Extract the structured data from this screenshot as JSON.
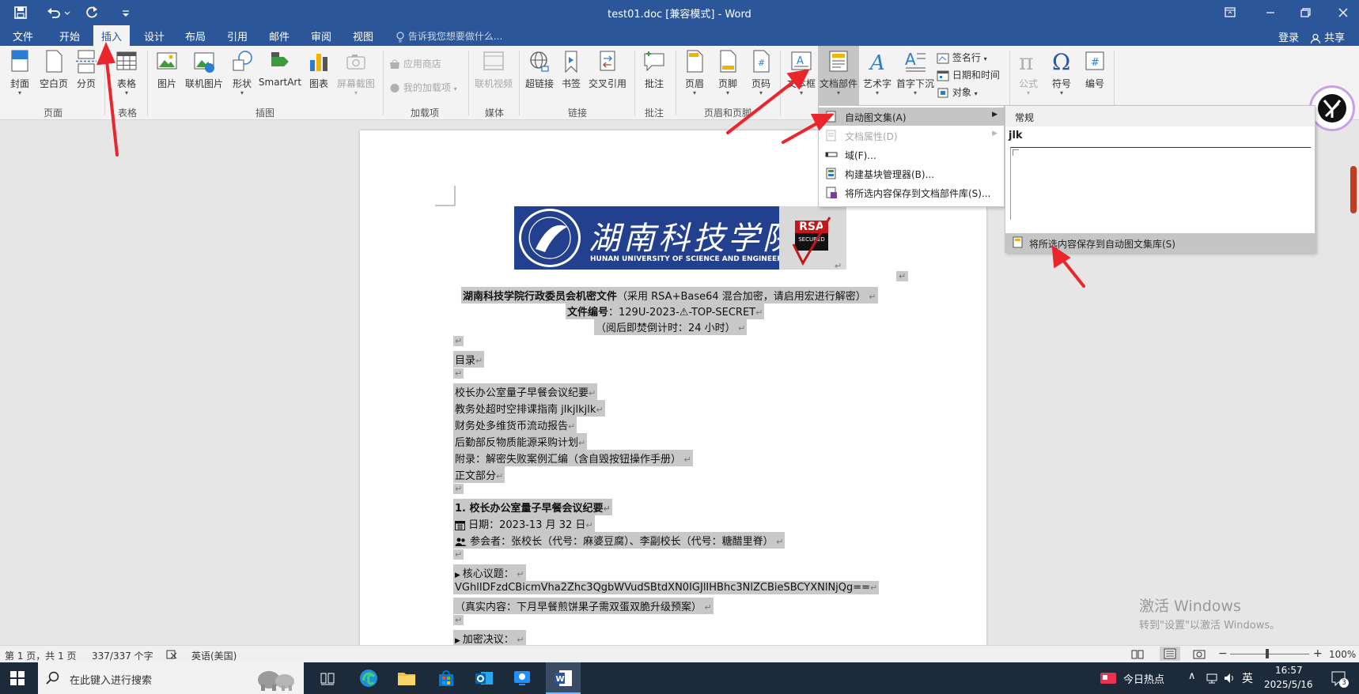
{
  "titlebar": {
    "title": "test01.doc [兼容模式] - Word"
  },
  "tabs": [
    "文件",
    "开始",
    "插入",
    "设计",
    "布局",
    "引用",
    "邮件",
    "审阅",
    "视图"
  ],
  "active_tab": "插入",
  "tell_me": "告诉我您想要做什么...",
  "account": {
    "login": "登录",
    "share": "共享"
  },
  "ribbon": {
    "pages": {
      "cover": "封面",
      "blank": "空白页",
      "break": "分页",
      "group": "页面"
    },
    "tables": {
      "table": "表格",
      "group": "表格"
    },
    "illustrations": {
      "picture": "图片",
      "online_picture": "联机图片",
      "shapes": "形状",
      "smartart": "SmartArt",
      "chart": "图表",
      "screenshot": "屏幕截图",
      "group": "插图"
    },
    "addins": {
      "store": "应用商店",
      "my_addins": "我的加载项",
      "group": "加载项"
    },
    "media": {
      "online_video": "联机视频",
      "group": "媒体"
    },
    "links": {
      "hyperlink": "超链接",
      "bookmark": "书签",
      "crossref": "交叉引用",
      "group": "链接"
    },
    "comments": {
      "comment": "批注",
      "group": "批注"
    },
    "header_footer": {
      "header": "页眉",
      "footer": "页脚",
      "page_number": "页码",
      "group": "页眉和页脚"
    },
    "text": {
      "textbox": "文本框",
      "quickparts": "文档部件",
      "wordart": "艺术字",
      "dropcap": "首字下沉",
      "signature": "签名行",
      "datetime": "日期和时间",
      "object": "对象"
    },
    "symbols": {
      "equation": "公式",
      "symbol": "符号",
      "number": "编号"
    }
  },
  "quickparts_menu": [
    {
      "label": "自动图文集(A)",
      "hover": true,
      "submenu": true,
      "disabled": false
    },
    {
      "label": "文档属性(D)",
      "hover": false,
      "submenu": true,
      "disabled": true
    },
    {
      "label": "域(F)...",
      "hover": false,
      "submenu": false,
      "disabled": false
    },
    {
      "label": "构建基块管理器(B)...",
      "hover": false,
      "submenu": false,
      "disabled": false
    },
    {
      "label": "将所选内容保存到文档部件库(S)...",
      "hover": false,
      "submenu": false,
      "disabled": false
    }
  ],
  "autotext_menu": {
    "category": "常规",
    "entry_name": "jlk",
    "save_label": "将所选内容保存到自动图文集库(S)"
  },
  "document": {
    "banner": {
      "cn": "湖南科技学院",
      "en": "HUNAN UNIVERSITY OF SCIENCE AND ENGINEERING",
      "badge_top": "RSA",
      "badge_bottom": "SECURED"
    },
    "title_bold": "湖南科技学院行政委员会机密文件",
    "title_rest": "（采用 RSA+Base64 混合加密，请启用宏进行解密）",
    "docno_label": "文件编号",
    "docno_value": "：129U-2023-⚠-TOP-SECRET",
    "countdown": "（阅后即焚倒计时：24 小时）",
    "toc_title": "目录",
    "toc": [
      "校长办公室量子早餐会议纪要",
      "教务处超时空排课指南 jlkjlkjlk",
      "财务处多维货币流动报告",
      "后勤部反物质能源采购计划",
      "附录：解密失败案例汇编（含自毁按钮操作手册）",
      "正文部分"
    ],
    "section1_title": "1.  校长办公室量子早餐会议纪要",
    "date_line": "日期：2023-13 月 32 日",
    "attendees_line": "参会者：张校长（代号：麻婆豆腐）、李副校长（代号：糖醋里脊）",
    "core_topic": "核心议题：",
    "cipher": "VGhlIDFzdCBicmVha2Zhc3QgbWVudSBtdXN0IGJlIHBhc3NlZCBieSBCYXNlNjQg==",
    "real_content": "（真实内容：下月早餐煎饼果子需双蛋双脆升级预案）",
    "encrypted_decision": "加密决议："
  },
  "statusbar": {
    "page": "第 1 页，共 1 页",
    "words": "337/337 个字",
    "language": "英语(美国)",
    "zoom": "100%"
  },
  "watermark": {
    "line1": "激活 Windows",
    "line2": "转到\"设置\"以激活 Windows。"
  },
  "taskbar": {
    "search_placeholder": "在此键入进行搜索",
    "news": "今日热点",
    "ime": "英",
    "time": "16:57",
    "date": "2025/5/16",
    "notification_count": "3"
  }
}
